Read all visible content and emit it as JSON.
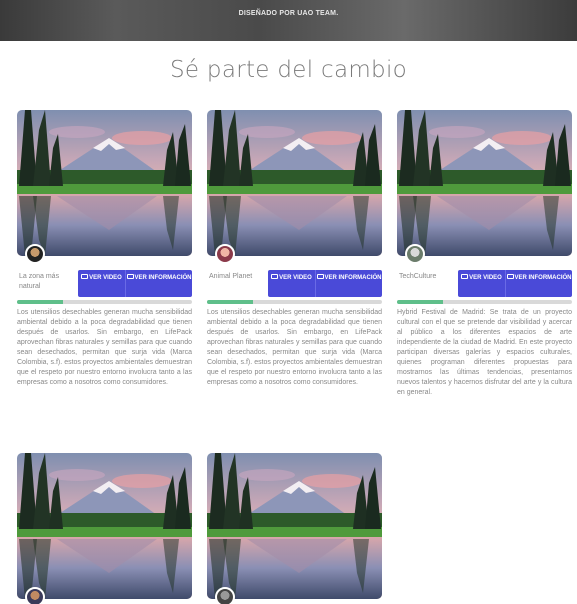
{
  "banner": {
    "text": "DISEÑADO POR UAO TEAM."
  },
  "section": {
    "title": "Sé parte del cambio"
  },
  "cards": [
    {
      "name": "La zona más natural",
      "video_label": "VER VIDEO",
      "info_label": "VER INFORMACIÓN",
      "progress": 0.26,
      "description": "Los utensilios desechables generan mucha sensibilidad ambiental debido a la poca degradabilidad que tienen después de usarlos. Sin embargo, en LifePack aprovechan fibras naturales y semillas para que cuando sean desechados, permitan que surja vida (Marca Colombia, s.f). estos proyectos ambientales demuestran que el respeto por nuestro entorno involucra tanto a las empresas como a nosotros como consumidores."
    },
    {
      "name": "Animal Planet",
      "video_label": "VER VIDEO",
      "info_label": "VER INFORMACIÓN",
      "progress": 0.26,
      "description": "Los utensilios desechables generan mucha sensibilidad ambiental debido a la poca degradabilidad que tienen después de usarlos. Sin embargo, en LifePack aprovechan fibras naturales y semillas para que cuando sean desechados, permitan que surja vida (Marca Colombia, s.f). estos proyectos ambientales demuestran que el respeto por nuestro entorno involucra tanto a las empresas como a nosotros como consumidores."
    },
    {
      "name": "TechCulture",
      "video_label": "VER VIDEO",
      "info_label": "VER INFORMACIÓN",
      "progress": 0.26,
      "description": "Hybrid Festival de Madrid: Se trata de un proyecto cultural con el que se pretende dar visibilidad y acercar al público a los diferentes espacios de arte independiente de la ciudad de Madrid. En este proyecto participan diversas galerías y espacios culturales, quienes programan diferentes propuestas para mostrarnos las últimas tendencias, presentarnos nuevos talentos y hacernos disfrutar del arte y la cultura en general."
    },
    {
      "name": "",
      "progress": 0
    },
    {
      "name": "",
      "progress": 0
    }
  ]
}
